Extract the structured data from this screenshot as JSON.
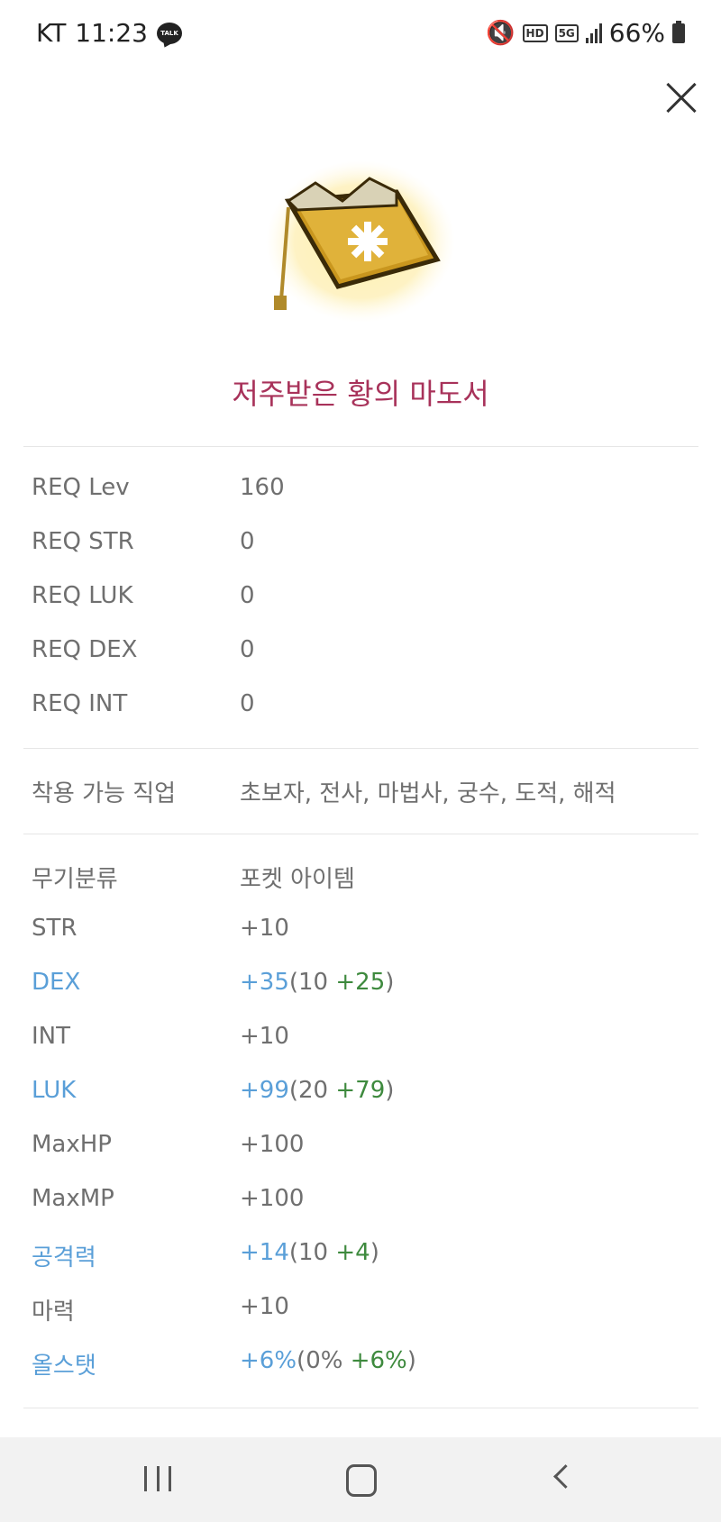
{
  "status_bar": {
    "carrier": "KT",
    "time": "11:23",
    "talk_badge": "TALK",
    "hd_badge": "HD",
    "net_badge": "5G",
    "battery_percent": "66%"
  },
  "item": {
    "name": "저주받은 황의 마도서",
    "image": "cursed-yellow-grimoire-icon"
  },
  "requirements": [
    {
      "label": "REQ Lev",
      "value": "160"
    },
    {
      "label": "REQ STR",
      "value": "0"
    },
    {
      "label": "REQ LUK",
      "value": "0"
    },
    {
      "label": "REQ DEX",
      "value": "0"
    },
    {
      "label": "REQ INT",
      "value": "0"
    }
  ],
  "jobs": {
    "label": "착용 가능 직업",
    "value": "초보자, 전사, 마법사, 궁수, 도적, 해적"
  },
  "weapon_type": {
    "label": "무기분류",
    "value": "포켓 아이템"
  },
  "stats": [
    {
      "label": "STR",
      "total": "+10"
    },
    {
      "label": "DEX",
      "total": "+35",
      "base_prefix": "(10 ",
      "bonus": "+25",
      "suffix": ")"
    },
    {
      "label": "INT",
      "total": "+10"
    },
    {
      "label": "LUK",
      "total": "+99",
      "base_prefix": "(20 ",
      "bonus": "+79",
      "suffix": ")"
    },
    {
      "label": "MaxHP",
      "total": "+100"
    },
    {
      "label": "MaxMP",
      "total": "+100"
    },
    {
      "label": "공격력",
      "total": "+14",
      "base_prefix": "(10 ",
      "bonus": "+4",
      "suffix": ")"
    },
    {
      "label": "마력",
      "total": "+10"
    },
    {
      "label": "올스탯",
      "total": "+6%",
      "base_prefix": "(0% ",
      "bonus": "+6%",
      "suffix": ")"
    }
  ],
  "colors": {
    "title": "#a8325a",
    "enhanced_label": "#5a9fd8",
    "bonus": "#3e8a3e"
  }
}
